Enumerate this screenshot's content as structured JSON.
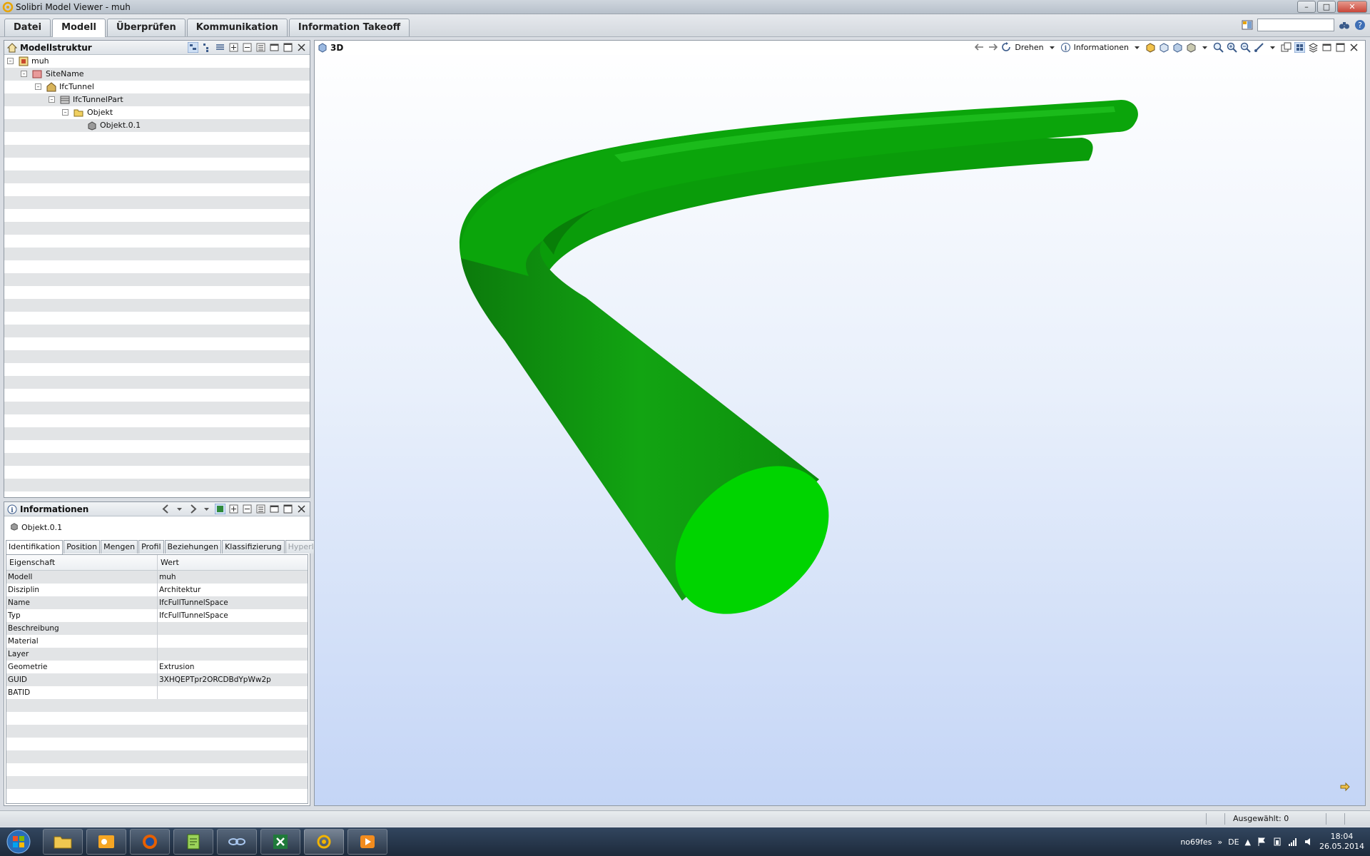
{
  "window": {
    "title": "Solibri Model Viewer - muh"
  },
  "menu": {
    "tabs": [
      "Datei",
      "Modell",
      "Überprüfen",
      "Kommunikation",
      "Information Takeoff"
    ],
    "active_tab": "Modell"
  },
  "search": {
    "value": ""
  },
  "model_tree": {
    "title": "Modellstruktur",
    "nodes": [
      {
        "label": "muh",
        "depth": 0
      },
      {
        "label": "SiteName",
        "depth": 1
      },
      {
        "label": "IfcTunnel",
        "depth": 2
      },
      {
        "label": "IfcTunnelPart",
        "depth": 3
      },
      {
        "label": "Objekt",
        "depth": 4
      },
      {
        "label": "Objekt.0.1",
        "depth": 5
      }
    ]
  },
  "info_panel": {
    "title": "Informationen",
    "selected_object": "Objekt.0.1",
    "tabs": [
      "Identifikation",
      "Position",
      "Mengen",
      "Profil",
      "Beziehungen",
      "Klassifizierung",
      "Hyperlinks"
    ],
    "active_tab": "Identifikation",
    "disabled_tabs": [
      "Hyperlinks"
    ],
    "columns": [
      "Eigenschaft",
      "Wert"
    ],
    "rows": [
      [
        "Modell",
        "muh"
      ],
      [
        "Disziplin",
        "Architektur"
      ],
      [
        "Name",
        "IfcFullTunnelSpace"
      ],
      [
        "Typ",
        "IfcFullTunnelSpace"
      ],
      [
        "Beschreibung",
        ""
      ],
      [
        "Material",
        ""
      ],
      [
        "Layer",
        ""
      ],
      [
        "Geometrie",
        "Extrusion"
      ],
      [
        "GUID",
        "3XHQEPTpr2ORCDBdYpWw2p"
      ],
      [
        "BATID",
        ""
      ]
    ]
  },
  "viewport": {
    "title": "3D",
    "rotate_label": "Drehen",
    "info_label": "Informationen",
    "model_color": "#0fb00f"
  },
  "status": {
    "selected": "Ausgewählt: 0"
  },
  "taskbar": {
    "apps": [
      "explorer-icon",
      "outlook-icon",
      "firefox-icon",
      "notepad-icon",
      "app-icon",
      "excel-icon",
      "solibri-icon",
      "media-icon"
    ],
    "user": "no69fes",
    "language": "DE",
    "time": "18:04",
    "date": "26.05.2014"
  }
}
